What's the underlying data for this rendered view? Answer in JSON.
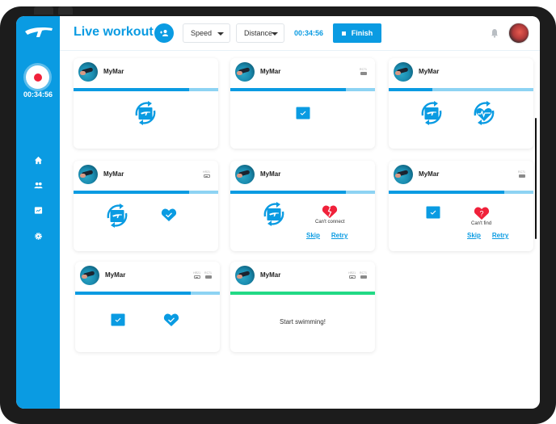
{
  "app": {
    "title": "Live workout",
    "brand_color": "#0a9be2",
    "record_color": "#f0213a",
    "success_color": "#22d985",
    "error_color": "#f0213a"
  },
  "sidebar": {
    "logo_icon": "brand-logo-icon",
    "record_icon": "record-icon",
    "timer": "00:34:56",
    "items": [
      {
        "name": "home",
        "icon": "home-icon"
      },
      {
        "name": "users",
        "icon": "users-icon"
      },
      {
        "name": "workouts",
        "icon": "chart-icon"
      },
      {
        "name": "settings",
        "icon": "gear-icon"
      }
    ]
  },
  "toolbar": {
    "add_user_icon": "add-user-icon",
    "metric1": "Speed",
    "metric2": "Distance",
    "timer": "00:34:56",
    "finish_label": "Finish",
    "notification_icon": "bell-icon",
    "avatar": "user-avatar"
  },
  "cards": [
    {
      "name": "MyMar",
      "devices": [],
      "progress": 0.8,
      "status": "syncing-device",
      "slots": [
        "sync-device"
      ]
    },
    {
      "name": "MyMar",
      "devices": [
        {
          "label": "RC71",
          "type": "battery-full"
        }
      ],
      "progress": 0.8,
      "status": "device-connected",
      "slots": [
        "device-ok"
      ]
    },
    {
      "name": "MyMar",
      "devices": [],
      "progress": 0.3,
      "status": "syncing",
      "slots": [
        "sync-device",
        "sync-heart"
      ]
    },
    {
      "name": "MyMar",
      "devices": [
        {
          "label": "HR21",
          "type": "battery-low"
        }
      ],
      "progress": 0.8,
      "status": "syncing-device",
      "slots": [
        "sync-device",
        "heart-ok"
      ]
    },
    {
      "name": "MyMar",
      "devices": [],
      "progress": 0.8,
      "status": "heart-error",
      "slots": [
        "sync-device",
        "heart-broken"
      ],
      "error_text": "Can't connect",
      "skip_label": "Skip",
      "retry_label": "Retry"
    },
    {
      "name": "MyMar",
      "devices": [
        {
          "label": "RC71",
          "type": "battery-full"
        }
      ],
      "progress": 0.8,
      "status": "heart-not-found",
      "slots": [
        "device-ok",
        "heart-unknown"
      ],
      "error_text": "Can't find",
      "skip_label": "Skip",
      "retry_label": "Retry"
    },
    {
      "name": "MyMar",
      "devices": [
        {
          "label": "HR21",
          "type": "battery-low"
        },
        {
          "label": "RC71",
          "type": "battery-full"
        }
      ],
      "progress": 0.8,
      "status": "ready",
      "slots": [
        "device-ok",
        "heart-ok"
      ]
    },
    {
      "name": "MyMar",
      "devices": [
        {
          "label": "HR21",
          "type": "battery-low"
        },
        {
          "label": "RC71",
          "type": "battery-full"
        }
      ],
      "progress": 1.0,
      "status": "started",
      "slots": [],
      "message": "Start swimming!"
    }
  ]
}
